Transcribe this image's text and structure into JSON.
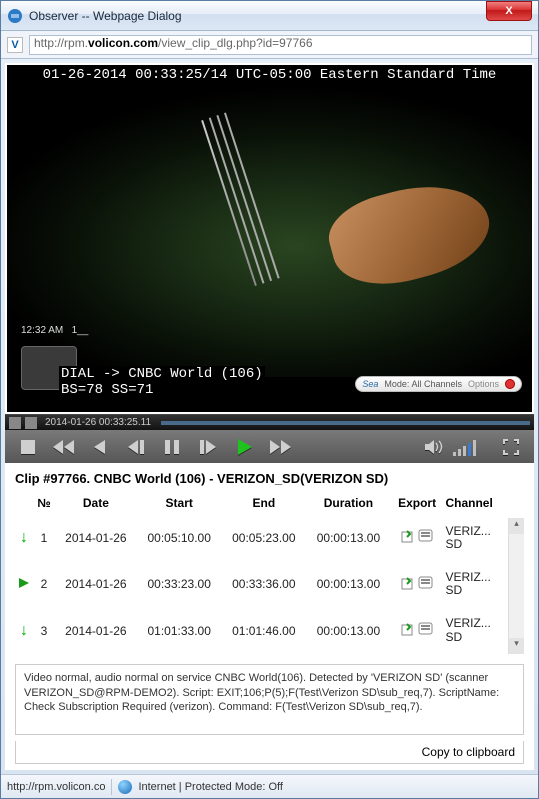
{
  "window": {
    "title": "Observer -- Webpage Dialog",
    "close": "X"
  },
  "address": {
    "favicon_letter": "V",
    "url_prefix": "http://rpm.",
    "url_bold": "volicon.com",
    "url_suffix": "/view_clip_dlg.php?id=97766"
  },
  "video": {
    "top_overlay": "01-26-2014 00:33:25/14 UTC-05:00 Eastern Standard Time",
    "clock": "12:32 AM",
    "line1": "DIAL -> CNBC World (106)",
    "line2": "BS=78 SS=71",
    "mode_pre": "Sea",
    "mode_label": "Mode: All Channels",
    "mode_options": "Options"
  },
  "seek": {
    "timestamp": "2014-01-26 00:33:25.11"
  },
  "clip": {
    "title": "Clip #97766. CNBC World (106) - VERIZON_SD(VERIZON SD)",
    "headers": {
      "num": "№",
      "date": "Date",
      "start": "Start",
      "end": "End",
      "duration": "Duration",
      "export": "Export",
      "channel": "Channel"
    },
    "rows": [
      {
        "n": "1",
        "date": "2014-01-26",
        "start": "00:05:10.00",
        "end": "00:05:23.00",
        "duration": "00:00:13.00",
        "ch1": "VERIZ...",
        "ch2": "SD",
        "mark": "down"
      },
      {
        "n": "2",
        "date": "2014-01-26",
        "start": "00:33:23.00",
        "end": "00:33:36.00",
        "duration": "00:00:13.00",
        "ch1": "VERIZ...",
        "ch2": "SD",
        "mark": "play"
      },
      {
        "n": "3",
        "date": "2014-01-26",
        "start": "01:01:33.00",
        "end": "01:01:46.00",
        "duration": "00:00:13.00",
        "ch1": "VERIZ...",
        "ch2": "SD",
        "mark": "down"
      }
    ]
  },
  "notes": "Video normal, audio normal on service CNBC World(106). Detected by 'VERIZON SD' (scanner VERIZON_SD@RPM-DEMO2). Script: EXIT;106;P(5);F(Test\\Verizon SD\\sub_req,7). ScriptName: Check Subscription Required (verizon). Command: F(Test\\Verizon SD\\sub_req,7).",
  "copy": "Copy to clipboard",
  "status": {
    "url": "http://rpm.volicon.co",
    "zone": "Internet | Protected Mode: Off"
  }
}
